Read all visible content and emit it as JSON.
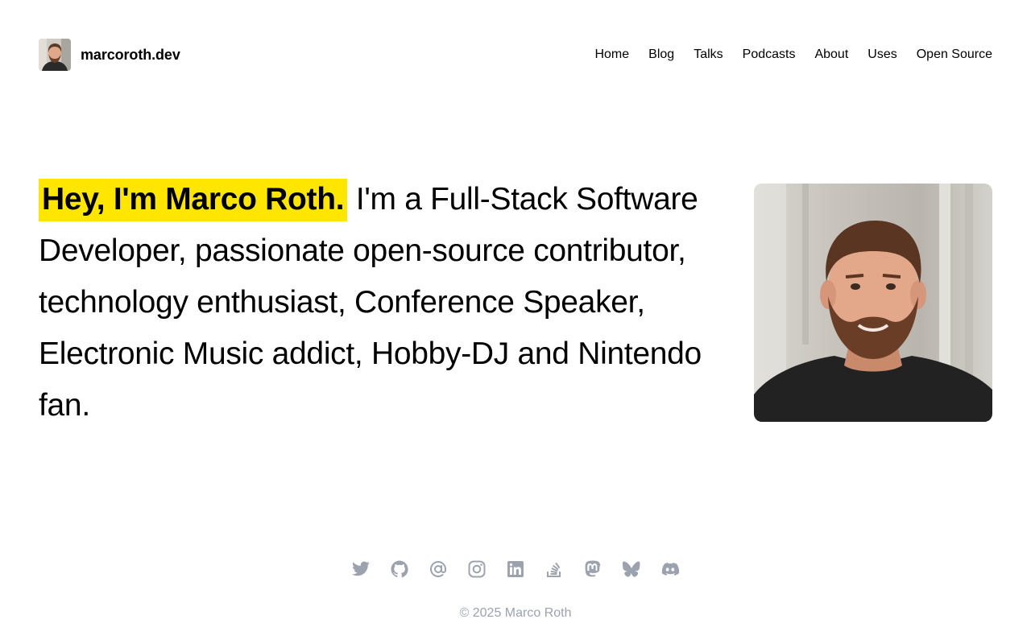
{
  "header": {
    "site_name": "marcoroth.dev",
    "nav": [
      "Home",
      "Blog",
      "Talks",
      "Podcasts",
      "About",
      "Uses",
      "Open Source"
    ]
  },
  "hero": {
    "highlight": "Hey, I'm Marco Roth.",
    "text": " I'm a Full-Stack Software Developer, passionate open-source contributor, technology enthusiast, Conference Speaker, Electronic Music addict, Hobby-DJ and Nintendo fan."
  },
  "social": [
    "twitter-icon",
    "github-icon",
    "email-icon",
    "instagram-icon",
    "linkedin-icon",
    "stackoverflow-icon",
    "mastodon-icon",
    "bluesky-icon",
    "discord-icon"
  ],
  "footer": {
    "copyright": "© 2025 Marco Roth"
  },
  "colors": {
    "highlight": "#ffe600",
    "footer_text": "#9ca3af",
    "text": "#000000"
  }
}
